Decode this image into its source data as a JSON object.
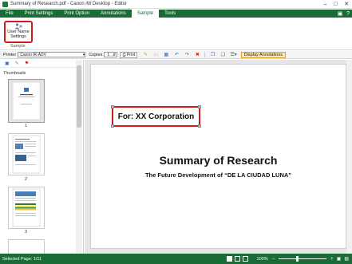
{
  "window": {
    "title": "Summary of Research.pdf - Canon iW Desktop - Editor",
    "minimize": "–",
    "maximize": "□",
    "close": "✕"
  },
  "ribbon": {
    "tabs": [
      "File",
      "Print Settings",
      "Print Option",
      "Annotations",
      "Sample",
      "Tools"
    ],
    "active_tab": "Sample",
    "user_name_button_label": "User Name Settings",
    "group_label": "Sample"
  },
  "toolbar": {
    "printer_label": "Printer",
    "printer_value": "Canon iR-ADV",
    "copies_label": "Copies",
    "copies_value": "1",
    "print_label": "Print",
    "display_annotations_label": "Display Annotations"
  },
  "thumbnails": {
    "title": "Thumbnails",
    "pages": [
      "1",
      "2",
      "3"
    ]
  },
  "document": {
    "annotation_text": "For: XX Corporation",
    "title": "Summary of Research",
    "subtitle": "The Future Development of “DE LA CIUDAD LUNA”"
  },
  "statusbar": {
    "selected_page": "Selected Page: 1/11",
    "zoom": "100%"
  },
  "colors": {
    "accent": "#1a6b35",
    "highlight": "#d21c1c"
  }
}
